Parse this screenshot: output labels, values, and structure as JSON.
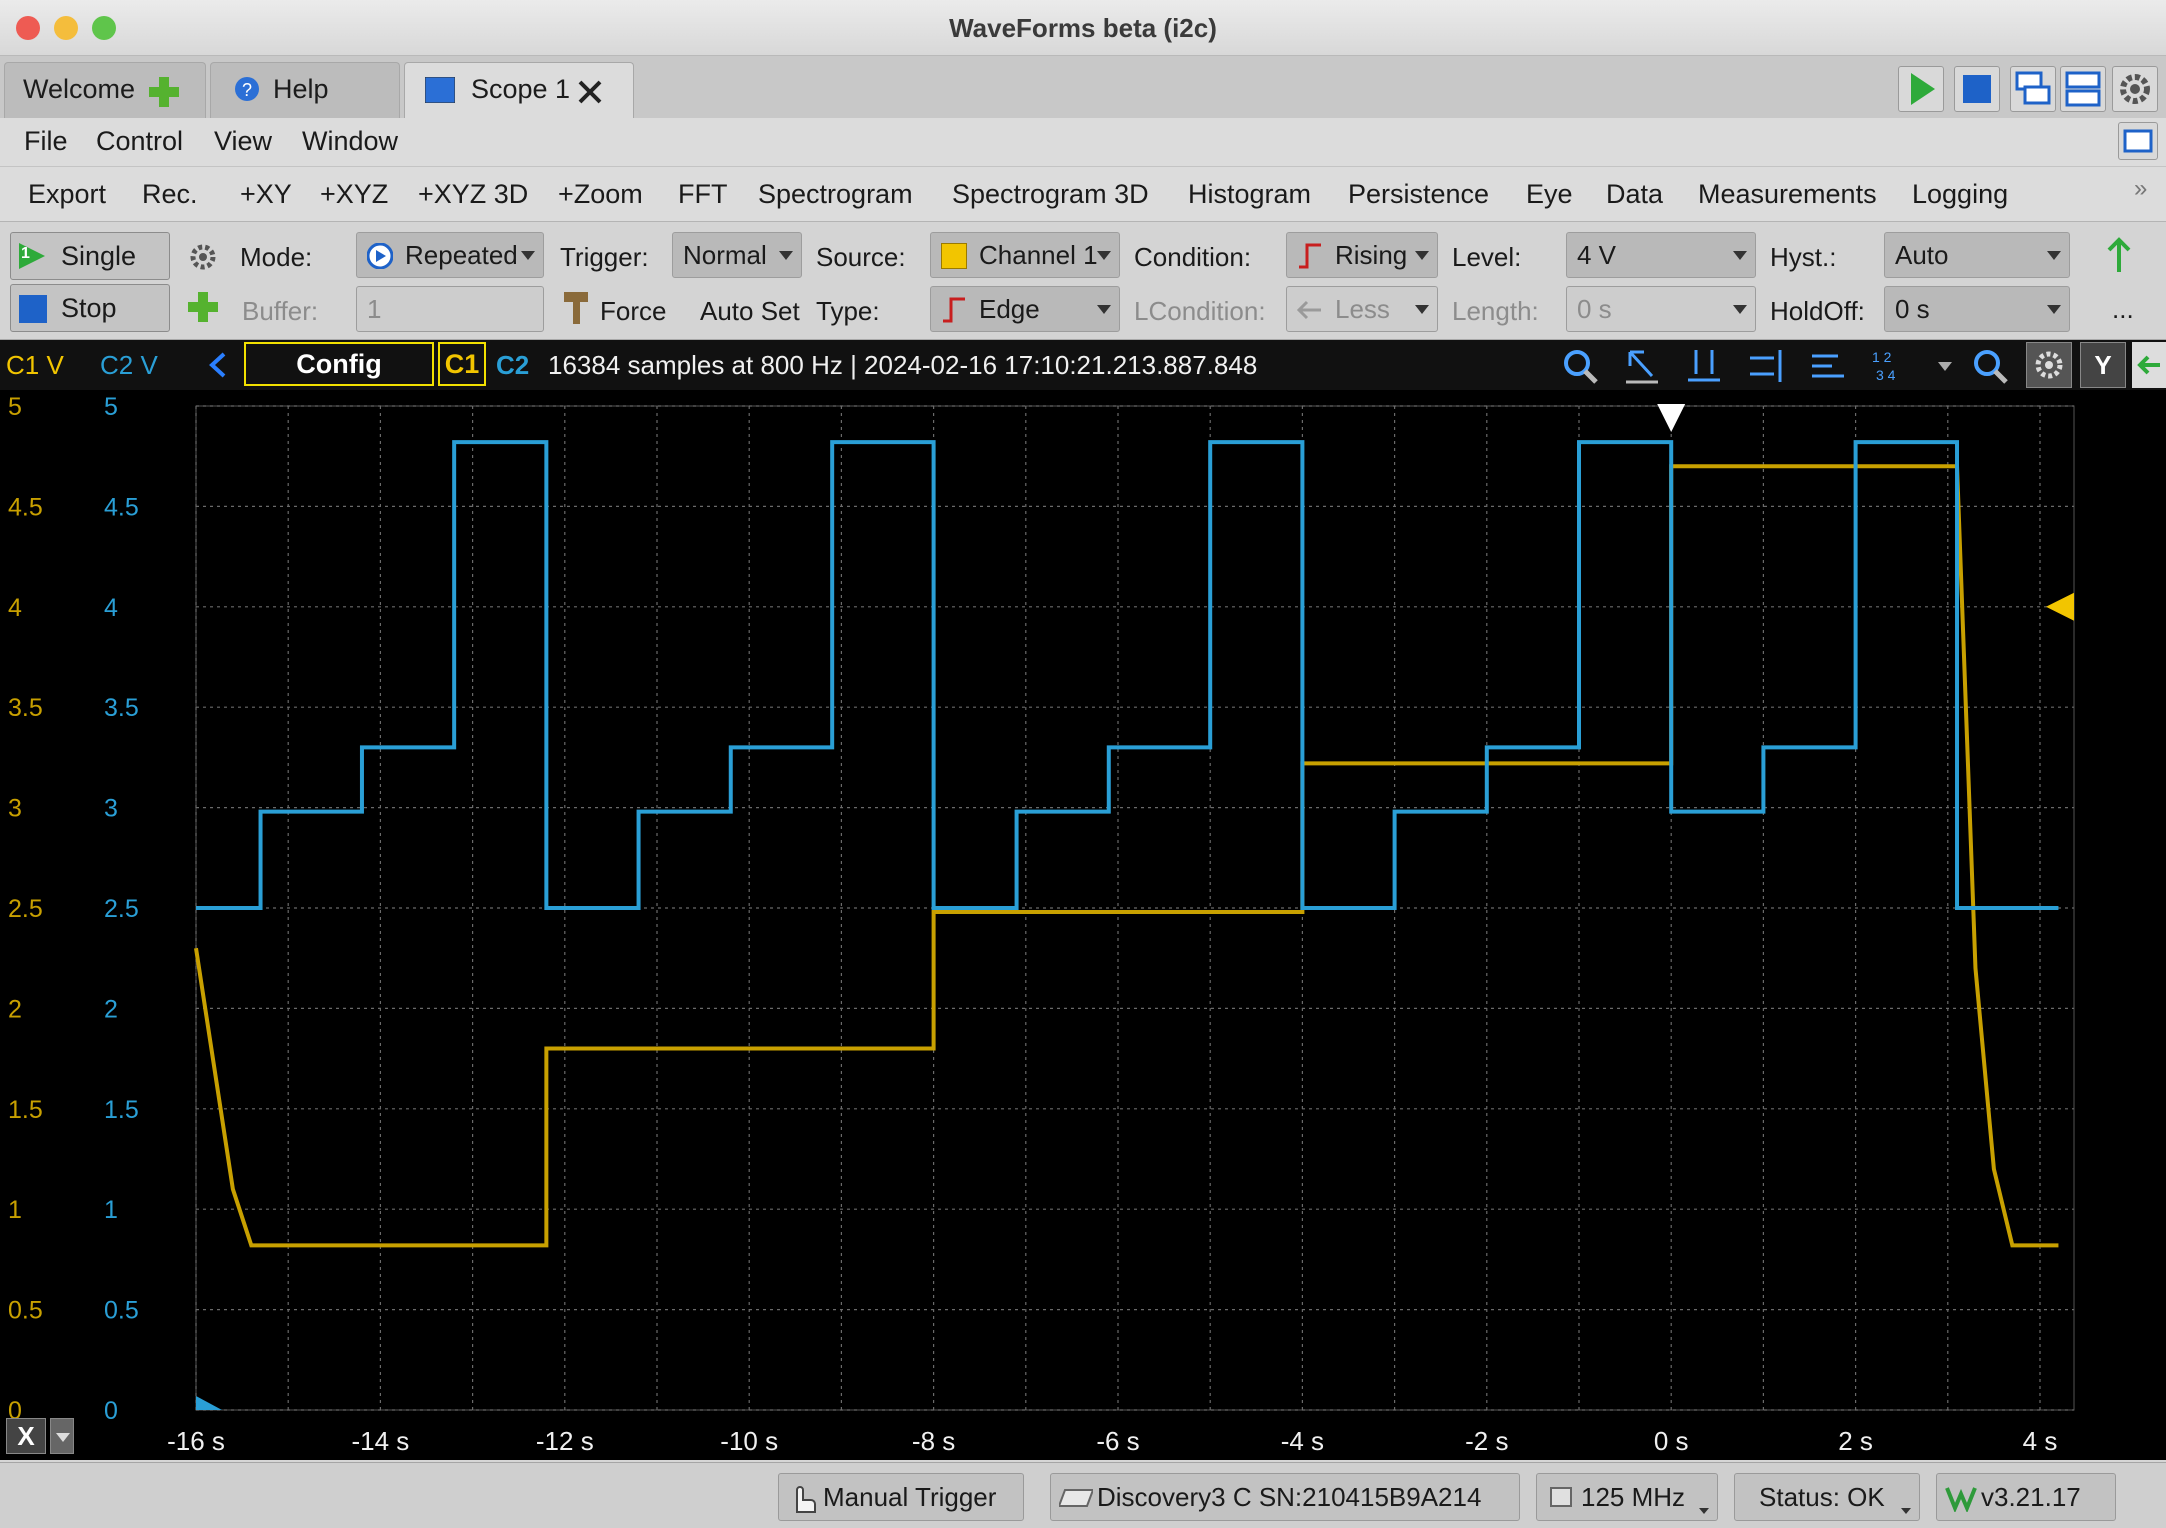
{
  "window": {
    "title": "WaveForms beta (i2c)"
  },
  "tabs": [
    {
      "label": "Welcome"
    },
    {
      "label": "Help"
    },
    {
      "label": "Scope 1"
    }
  ],
  "menu": [
    "File",
    "Control",
    "View",
    "Window"
  ],
  "toolbar": [
    "Export",
    "Rec.",
    "+XY",
    "+XYZ",
    "+XYZ 3D",
    "+Zoom",
    "FFT",
    "Spectrogram",
    "Spectrogram 3D",
    "Histogram",
    "Persistence",
    "Eye",
    "Data",
    "Measurements",
    "Logging"
  ],
  "toolbar_more": "»",
  "controls": {
    "single_label": "Single",
    "single_badge": "1",
    "stop_label": "Stop",
    "mode_label": "Mode:",
    "mode_value": "Repeated",
    "buffer_label": "Buffer:",
    "buffer_value": "1",
    "trigger_label": "Trigger:",
    "trigger_value": "Normal",
    "force_label": "Force",
    "autoset_label": "Auto Set",
    "source_label": "Source:",
    "source_value": "Channel 1",
    "type_label": "Type:",
    "type_value": "Edge",
    "condition_label": "Condition:",
    "condition_value": "Rising",
    "lcondition_label": "LCondition:",
    "lcondition_value": "Less",
    "level_label": "Level:",
    "level_value": "4 V",
    "length_label": "Length:",
    "length_value": "0 s",
    "hyst_label": "Hyst.:",
    "hyst_value": "Auto",
    "holdoff_label": "HoldOff:",
    "holdoff_value": "0 s",
    "more_label": "..."
  },
  "plotbar": {
    "c1_axis_label": "C1 V",
    "c2_axis_label": "C2 V",
    "config_label": "Config",
    "c1_tag": "C1",
    "c2_tag": "C2",
    "info": "16384 samples at 800 Hz  | 2024-02-16 17:10:21.213.887.848",
    "y_button": "Y"
  },
  "axis": {
    "y_ticks": [
      "5",
      "4.5",
      "4",
      "3.5",
      "3",
      "2.5",
      "2",
      "1.5",
      "1",
      "0.5",
      "0"
    ],
    "x_ticks": [
      "-16 s",
      "-14 s",
      "-12 s",
      "-10 s",
      "-8 s",
      "-6 s",
      "-4 s",
      "-2 s",
      "0 s",
      "2 s",
      "4 s"
    ],
    "x_button": "X"
  },
  "colors": {
    "c1": "#c8a000",
    "c2": "#2a9fd6",
    "background": "#000000",
    "grid": "#6a6a6a"
  },
  "chart_data": {
    "type": "line",
    "xlabel": "",
    "ylabel": "",
    "xlim": [
      -16,
      4.2
    ],
    "ylim": [
      0,
      5
    ],
    "grid": true,
    "series": [
      {
        "name": "C1",
        "points": [
          [
            -16,
            2.3
          ],
          [
            -15.6,
            1.1
          ],
          [
            -15.4,
            0.82
          ],
          [
            -12.2,
            0.82
          ],
          [
            -12.2,
            1.8
          ],
          [
            -8,
            1.8
          ],
          [
            -8,
            2.48
          ],
          [
            -4,
            2.48
          ],
          [
            -4,
            3.22
          ],
          [
            0,
            3.22
          ],
          [
            0,
            4.7
          ],
          [
            3.1,
            4.7
          ],
          [
            3.3,
            2.2
          ],
          [
            3.5,
            1.2
          ],
          [
            3.7,
            0.82
          ],
          [
            4.2,
            0.82
          ]
        ]
      },
      {
        "name": "C2",
        "points": [
          [
            -16,
            2.5
          ],
          [
            -15.3,
            2.5
          ],
          [
            -15.3,
            2.98
          ],
          [
            -14.2,
            2.98
          ],
          [
            -14.2,
            3.3
          ],
          [
            -13.2,
            3.3
          ],
          [
            -13.2,
            4.82
          ],
          [
            -12.2,
            4.82
          ],
          [
            -12.2,
            2.5
          ],
          [
            -11.2,
            2.5
          ],
          [
            -11.2,
            2.98
          ],
          [
            -10.2,
            2.98
          ],
          [
            -10.2,
            3.3
          ],
          [
            -9.1,
            3.3
          ],
          [
            -9.1,
            4.82
          ],
          [
            -8,
            4.82
          ],
          [
            -8,
            2.5
          ],
          [
            -7.1,
            2.5
          ],
          [
            -7.1,
            2.98
          ],
          [
            -6.1,
            2.98
          ],
          [
            -6.1,
            3.3
          ],
          [
            -5,
            3.3
          ],
          [
            -5,
            4.82
          ],
          [
            -4,
            4.82
          ],
          [
            -4,
            2.5
          ],
          [
            -3,
            2.5
          ],
          [
            -3,
            2.98
          ],
          [
            -2,
            2.98
          ],
          [
            -2,
            3.3
          ],
          [
            -1,
            3.3
          ],
          [
            -1,
            4.82
          ],
          [
            0,
            4.82
          ],
          [
            0,
            2.98
          ],
          [
            1,
            2.98
          ],
          [
            1,
            3.3
          ],
          [
            2,
            3.3
          ],
          [
            2,
            4.82
          ],
          [
            3.1,
            4.82
          ],
          [
            3.1,
            2.5
          ],
          [
            4.2,
            2.5
          ]
        ]
      }
    ]
  },
  "statusbar": {
    "manual_trigger": "Manual Trigger",
    "device": "Discovery3 C SN:210415B9A214",
    "clock": "125 MHz",
    "status": "Status: OK",
    "version": "v3.21.17"
  }
}
